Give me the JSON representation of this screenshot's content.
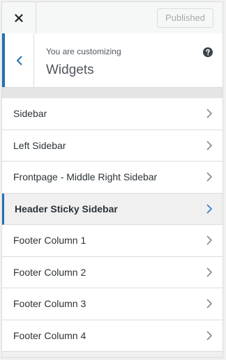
{
  "header": {
    "close_icon": "close-icon",
    "published_label": "Published"
  },
  "section": {
    "customizing_label": "You are customizing",
    "title": "Widgets",
    "back_icon": "chevron-left-icon",
    "help_icon": "help-icon"
  },
  "widget_areas": [
    {
      "label": "Sidebar",
      "active": false
    },
    {
      "label": "Left Sidebar",
      "active": false
    },
    {
      "label": "Frontpage - Middle Right Sidebar",
      "active": false
    },
    {
      "label": "Header Sticky Sidebar",
      "active": true
    },
    {
      "label": "Footer Column 1",
      "active": false
    },
    {
      "label": "Footer Column 2",
      "active": false
    },
    {
      "label": "Footer Column 3",
      "active": false
    },
    {
      "label": "Footer Column 4",
      "active": false
    }
  ],
  "colors": {
    "accent": "#2271b1",
    "active_chevron": "#3582c4",
    "chevron": "#8c8f94"
  }
}
